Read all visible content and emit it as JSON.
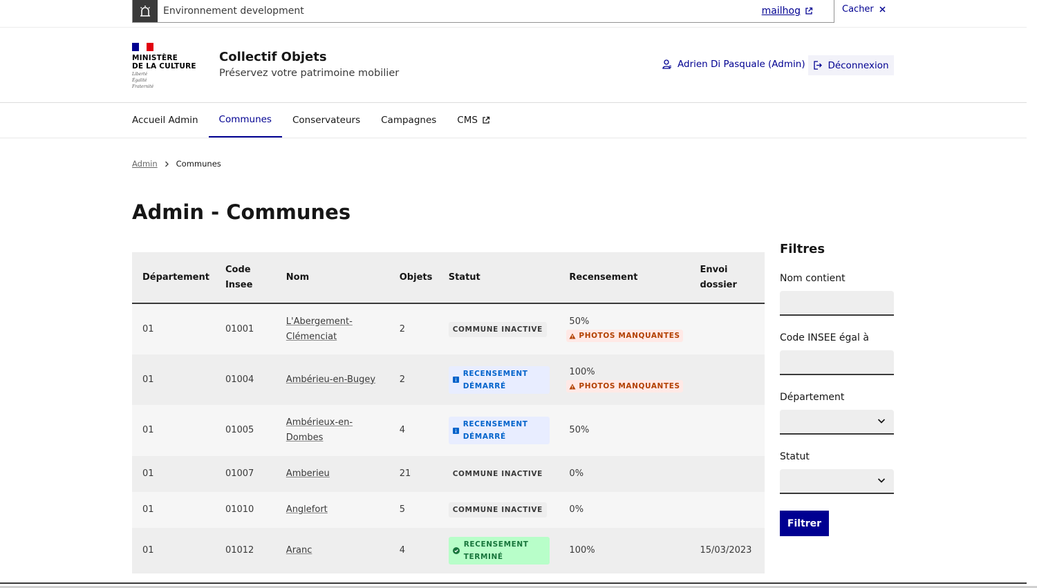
{
  "env_banner": {
    "text": "Environnement development",
    "link": "mailhog",
    "hide": "Cacher"
  },
  "header": {
    "logo_lines": [
      "MINISTÈRE",
      "DE LA CULTURE"
    ],
    "motto_lines": [
      "Liberté",
      "Égalité",
      "Fraternité"
    ],
    "title": "Collectif Objets",
    "tagline": "Préservez votre patrimoine mobilier",
    "user": "Adrien Di Pasquale (Admin)",
    "logout": "Déconnexion"
  },
  "nav": {
    "items": [
      {
        "label": "Accueil Admin"
      },
      {
        "label": "Communes"
      },
      {
        "label": "Conservateurs"
      },
      {
        "label": "Campagnes"
      },
      {
        "label": "CMS"
      }
    ]
  },
  "breadcrumb": {
    "root": "Admin",
    "current": "Communes"
  },
  "page_title": "Admin - Communes",
  "table": {
    "headers": {
      "departement": "Département",
      "code_insee": "Code Insee",
      "nom": "Nom",
      "objets": "Objets",
      "statut": "Statut",
      "recensement": "Recensement",
      "envoi": "Envoi dossier"
    },
    "rows": [
      {
        "dep": "01",
        "code": "01001",
        "nom": "L'Abergement-Clémenciat",
        "objets": "2",
        "statut": "COMMUNE INACTIVE",
        "rec": "50%",
        "warn": "PHOTOS MANQUANTES",
        "envoi": ""
      },
      {
        "dep": "01",
        "code": "01004",
        "nom": "Ambérieu-en-Bugey",
        "objets": "2",
        "statut": "RECENSEMENT DÉMARRÉ",
        "rec": "100%",
        "warn": "PHOTOS MANQUANTES",
        "envoi": ""
      },
      {
        "dep": "01",
        "code": "01005",
        "nom": "Ambérieux-en-Dombes",
        "objets": "4",
        "statut": "RECENSEMENT DÉMARRÉ",
        "rec": "50%",
        "warn": "",
        "envoi": ""
      },
      {
        "dep": "01",
        "code": "01007",
        "nom": "Amberieu",
        "objets": "21",
        "statut": "COMMUNE INACTIVE",
        "rec": "0%",
        "warn": "",
        "envoi": ""
      },
      {
        "dep": "01",
        "code": "01010",
        "nom": "Anglefort",
        "objets": "5",
        "statut": "COMMUNE INACTIVE",
        "rec": "0%",
        "warn": "",
        "envoi": ""
      },
      {
        "dep": "01",
        "code": "01012",
        "nom": "Aranc",
        "objets": "4",
        "statut": "RECENSEMENT TERMINÉ",
        "rec": "100%",
        "warn": "",
        "envoi": "15/03/2023"
      }
    ]
  },
  "filters": {
    "title": "Filtres",
    "nom_label": "Nom contient",
    "code_label": "Code INSEE égal à",
    "dep_label": "Département",
    "statut_label": "Statut",
    "submit": "Filtrer"
  },
  "colors": {
    "primary": "#000091",
    "info": "#0063cb",
    "success": "#18753c",
    "warning": "#b34000"
  }
}
